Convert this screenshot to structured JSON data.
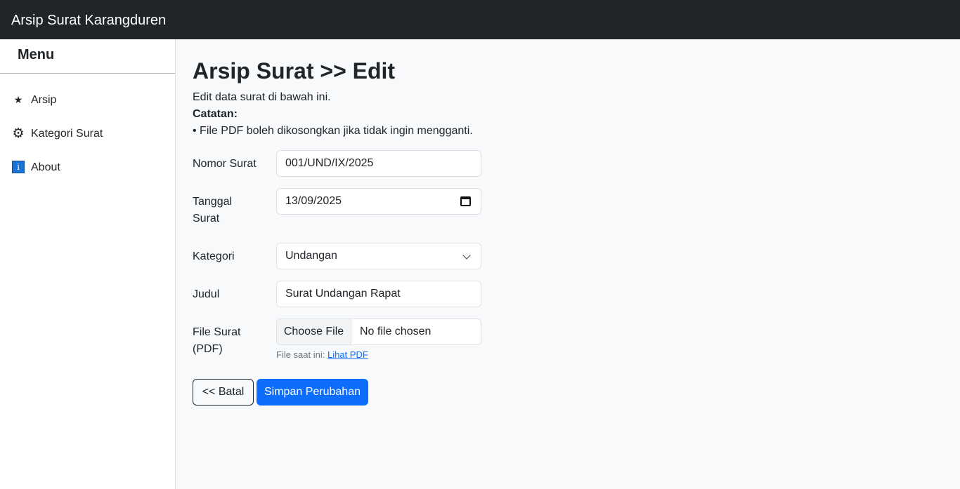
{
  "navbar": {
    "brand": "Arsip Surat Karangduren"
  },
  "sidebar": {
    "title": "Menu",
    "items": [
      {
        "label": "Arsip",
        "icon": "star-icon",
        "glyph": "★"
      },
      {
        "label": "Kategori Surat",
        "icon": "gear-icon",
        "glyph": "⚙"
      },
      {
        "label": "About",
        "icon": "info-icon",
        "glyph": "i"
      }
    ]
  },
  "main": {
    "title": "Arsip Surat >> Edit",
    "subtitle": "Edit data surat di bawah ini.",
    "note_title": "Catatan:",
    "note_item": "• File PDF boleh dikosongkan jika tidak ingin mengganti."
  },
  "form": {
    "nomor": {
      "label": "Nomor Surat",
      "value": "001/UND/IX/2025"
    },
    "tanggal": {
      "label_line1": "Tanggal",
      "label_line2": "Surat",
      "value": "13/09/2025"
    },
    "kategori": {
      "label": "Kategori",
      "value": "Undangan"
    },
    "judul": {
      "label": "Judul",
      "value": "Surat Undangan Rapat"
    },
    "file": {
      "label_line1": "File Surat",
      "label_line2": "(PDF)",
      "button": "Choose File",
      "status": "No file chosen",
      "hint_prefix": "File saat ini:",
      "hint_link": "Lihat PDF"
    }
  },
  "buttons": {
    "cancel": "<< Batal",
    "save": "Simpan Perubahan"
  },
  "colors": {
    "navbar": "#212529",
    "primary": "#0d6efd",
    "info_icon": "#1b73d1"
  }
}
